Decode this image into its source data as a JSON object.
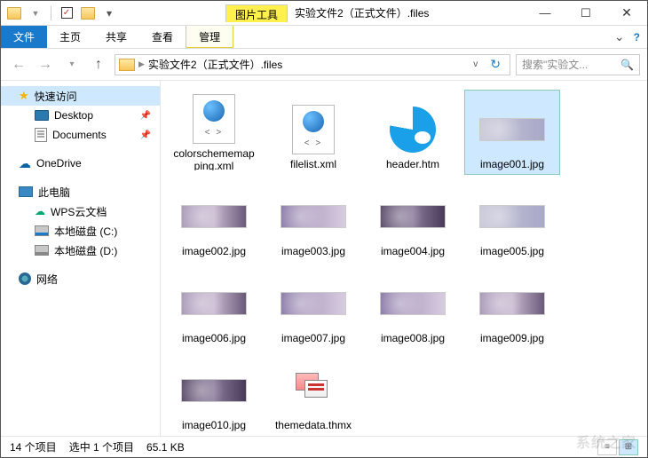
{
  "window": {
    "context_tab": "图片工具",
    "title": "实验文件2（正式文件）.files"
  },
  "ribbon": {
    "file": "文件",
    "tabs": [
      "主页",
      "共享",
      "查看"
    ],
    "context_tab": "管理"
  },
  "address": {
    "path": "实验文件2（正式文件）.files"
  },
  "search": {
    "placeholder": "搜索\"实验文..."
  },
  "sidebar": {
    "quick": {
      "label": "快速访问",
      "items": [
        {
          "label": "Desktop",
          "pinned": true
        },
        {
          "label": "Documents",
          "pinned": true
        }
      ]
    },
    "onedrive": "OneDrive",
    "thispc": {
      "label": "此电脑",
      "items": [
        {
          "label": "WPS云文档"
        },
        {
          "label": "本地磁盘 (C:)"
        },
        {
          "label": "本地磁盘 (D:)"
        }
      ]
    },
    "network": "网络"
  },
  "files": [
    {
      "name": "colorschememapping.xml",
      "type": "xml"
    },
    {
      "name": "filelist.xml",
      "type": "xml"
    },
    {
      "name": "header.htm",
      "type": "htm"
    },
    {
      "name": "image001.jpg",
      "type": "img",
      "selected": true
    },
    {
      "name": "image002.jpg",
      "type": "img"
    },
    {
      "name": "image003.jpg",
      "type": "img"
    },
    {
      "name": "image004.jpg",
      "type": "img"
    },
    {
      "name": "image005.jpg",
      "type": "img"
    },
    {
      "name": "image006.jpg",
      "type": "img"
    },
    {
      "name": "image007.jpg",
      "type": "img"
    },
    {
      "name": "image008.jpg",
      "type": "img"
    },
    {
      "name": "image009.jpg",
      "type": "img"
    },
    {
      "name": "image010.jpg",
      "type": "img"
    },
    {
      "name": "themedata.thmx",
      "type": "thmx"
    }
  ],
  "status": {
    "count": "14 个项目",
    "selection": "选中 1 个项目",
    "size": "65.1 KB"
  },
  "watermark": "系统之家"
}
